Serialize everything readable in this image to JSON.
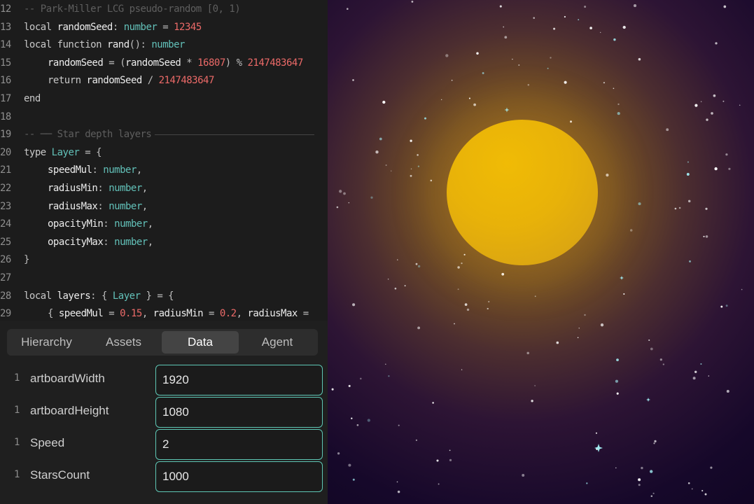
{
  "editor": {
    "lines": [
      {
        "n": "12",
        "parts": [
          [
            "cmt",
            "-- Park-Miller LCG pseudo-random [0, 1)"
          ]
        ]
      },
      {
        "n": "13",
        "parts": [
          [
            "kw",
            "local "
          ],
          [
            "id",
            "randomSeed"
          ],
          [
            "op",
            ": "
          ],
          [
            "type",
            "number"
          ],
          [
            "op",
            " = "
          ],
          [
            "num",
            "12345"
          ]
        ]
      },
      {
        "n": "14",
        "parts": [
          [
            "kw",
            "local function "
          ],
          [
            "id",
            "rand"
          ],
          [
            "op",
            "(): "
          ],
          [
            "type",
            "number"
          ]
        ]
      },
      {
        "n": "15",
        "indent": 1,
        "parts": [
          [
            "id",
            "randomSeed"
          ],
          [
            "op",
            " = ("
          ],
          [
            "id",
            "randomSeed"
          ],
          [
            "op",
            " * "
          ],
          [
            "num",
            "16807"
          ],
          [
            "op",
            ") % "
          ],
          [
            "num",
            "2147483647"
          ]
        ]
      },
      {
        "n": "16",
        "indent": 1,
        "parts": [
          [
            "kw",
            "return "
          ],
          [
            "id",
            "randomSeed"
          ],
          [
            "op",
            " / "
          ],
          [
            "num",
            "2147483647"
          ]
        ]
      },
      {
        "n": "17",
        "parts": [
          [
            "kw",
            "end"
          ]
        ]
      },
      {
        "n": "18",
        "parts": []
      },
      {
        "n": "19",
        "rule": true,
        "parts": [
          [
            "cmt",
            "-- ── Star depth layers"
          ]
        ]
      },
      {
        "n": "20",
        "parts": [
          [
            "kw",
            "type "
          ],
          [
            "type",
            "Layer"
          ],
          [
            "op",
            " = {"
          ]
        ]
      },
      {
        "n": "21",
        "indent": 1,
        "parts": [
          [
            "id",
            "speedMul"
          ],
          [
            "op",
            ": "
          ],
          [
            "type",
            "number"
          ],
          [
            "op",
            ","
          ]
        ]
      },
      {
        "n": "22",
        "indent": 1,
        "parts": [
          [
            "id",
            "radiusMin"
          ],
          [
            "op",
            ": "
          ],
          [
            "type",
            "number"
          ],
          [
            "op",
            ","
          ]
        ]
      },
      {
        "n": "23",
        "indent": 1,
        "parts": [
          [
            "id",
            "radiusMax"
          ],
          [
            "op",
            ": "
          ],
          [
            "type",
            "number"
          ],
          [
            "op",
            ","
          ]
        ]
      },
      {
        "n": "24",
        "indent": 1,
        "parts": [
          [
            "id",
            "opacityMin"
          ],
          [
            "op",
            ": "
          ],
          [
            "type",
            "number"
          ],
          [
            "op",
            ","
          ]
        ]
      },
      {
        "n": "25",
        "indent": 1,
        "parts": [
          [
            "id",
            "opacityMax"
          ],
          [
            "op",
            ": "
          ],
          [
            "type",
            "number"
          ],
          [
            "op",
            ","
          ]
        ]
      },
      {
        "n": "26",
        "parts": [
          [
            "op",
            "}"
          ]
        ]
      },
      {
        "n": "27",
        "parts": []
      },
      {
        "n": "28",
        "parts": [
          [
            "kw",
            "local "
          ],
          [
            "id",
            "layers"
          ],
          [
            "op",
            ": { "
          ],
          [
            "type",
            "Layer"
          ],
          [
            "op",
            " } = {"
          ]
        ]
      },
      {
        "n": "29",
        "indent": 1,
        "parts": [
          [
            "op",
            "{ "
          ],
          [
            "id",
            "speedMul"
          ],
          [
            "op",
            " = "
          ],
          [
            "num",
            "0.15"
          ],
          [
            "op",
            ", "
          ],
          [
            "id",
            "radiusMin"
          ],
          [
            "op",
            " = "
          ],
          [
            "num",
            "0.2"
          ],
          [
            "op",
            ", "
          ],
          [
            "id",
            "radiusMax"
          ],
          [
            "op",
            " ="
          ]
        ]
      }
    ]
  },
  "tabs": [
    {
      "label": "Hierarchy",
      "active": false
    },
    {
      "label": "Assets",
      "active": false
    },
    {
      "label": "Data",
      "active": true
    },
    {
      "label": "Agent",
      "active": false
    }
  ],
  "properties": [
    {
      "type": "1",
      "name": "artboardWidth",
      "value": "1920"
    },
    {
      "type": "1",
      "name": "artboardHeight",
      "value": "1080"
    },
    {
      "type": "1",
      "name": "Speed",
      "value": "2"
    },
    {
      "type": "1",
      "name": "StarsCount",
      "value": "1000"
    }
  ],
  "artboard": {
    "sun_color": "#e8b209",
    "glow_color": "#96691c",
    "sky_color": "#16082a",
    "star_color": "#ffffff",
    "star_accent_color": "#9fe8ee"
  }
}
